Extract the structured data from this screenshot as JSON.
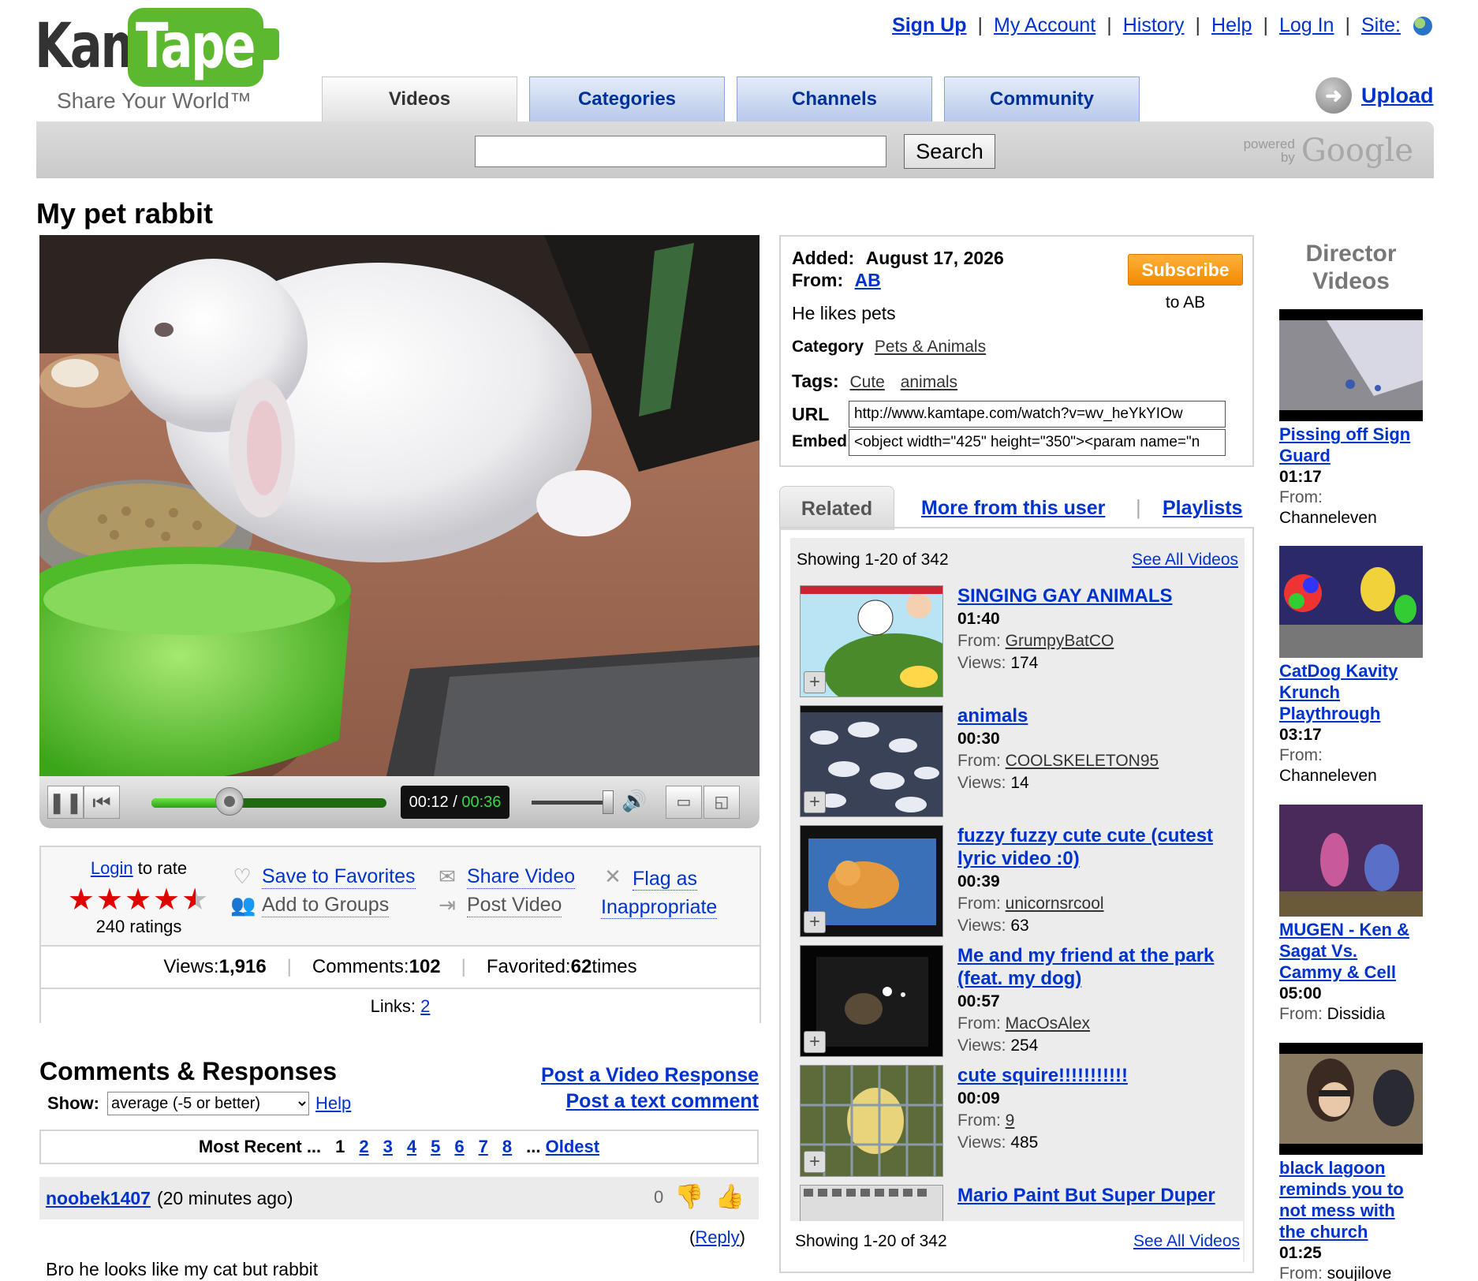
{
  "header": {
    "logo_left": "Kam",
    "logo_right": "Tape",
    "tagline": "Share Your World™",
    "links": [
      "Sign Up",
      "My Account",
      "History",
      "Help",
      "Log In",
      "Site:"
    ],
    "tabs": [
      "Videos",
      "Categories",
      "Channels",
      "Community"
    ],
    "active_tab": "Videos",
    "upload_label": "Upload",
    "search_value": "",
    "search_button": "Search",
    "powered_line1": "powered",
    "powered_line2": "by",
    "powered_brand": "Google"
  },
  "video": {
    "title": "My pet rabbit",
    "time_current": "00:12",
    "time_sep": " / ",
    "time_total": "00:36",
    "progress_fraction": 0.333
  },
  "rating": {
    "login_label": "Login",
    "to_rate": " to rate",
    "stars": 4.5,
    "ratings_count": "240 ratings"
  },
  "actions": {
    "save_favorites": "Save to Favorites",
    "add_groups": "Add to Groups",
    "share_video": "Share Video",
    "post_video": "Post Video",
    "flag_line1": "Flag as",
    "flag_line2": "Inappropriate"
  },
  "stats": {
    "views_label": "Views: ",
    "views": "1,916",
    "comments_label": "Comments: ",
    "comments": "102",
    "favorited_label": "Favorited: ",
    "favorited": "62",
    "favorited_suffix": " times",
    "links_label": "Links: ",
    "links": "2"
  },
  "comments": {
    "title": "Comments & Responses",
    "post_video_response": "Post a Video Response",
    "post_text_comment": "Post a text comment",
    "show_label": "Show:",
    "show_value": "average (-5 or better)",
    "help": "Help",
    "pager_most_recent": "Most Recent ...",
    "pager_current": "1",
    "pager_pages": [
      "2",
      "3",
      "4",
      "5",
      "6",
      "7",
      "8"
    ],
    "pager_oldest_prefix": "...",
    "pager_oldest": "Oldest",
    "first": {
      "user": "noobek1407",
      "when": "(20 minutes ago)",
      "votes": "0",
      "reply_open": "(",
      "reply": "Reply",
      "reply_close": ")",
      "text": "Bro he looks like my cat but rabbit"
    }
  },
  "info": {
    "added_label": "Added:",
    "added": "August 17, 2026",
    "from_label": "From:",
    "from": "AB",
    "subscribe": "Subscribe",
    "subscribe_to": "to AB",
    "description": "He likes pets",
    "category_label": "Category",
    "category": "Pets & Animals",
    "tags_label": "Tags:",
    "tags": [
      "Cute",
      "animals"
    ],
    "url_label": "URL",
    "url": "http://www.kamtape.com/watch?v=wv_heYkYIOw",
    "embed_label": "Embed",
    "embed": "<object width=\"425\" height=\"350\"><param name=\"n"
  },
  "related": {
    "tabs": [
      "Related",
      "More from this user",
      "Playlists"
    ],
    "showing": "Showing 1-20 of 342",
    "see_all": "See All Videos",
    "items": [
      {
        "title": "SINGING GAY ANIMALS",
        "duration": "01:40",
        "from": "GrumpyBatCO",
        "views": "174"
      },
      {
        "title": "animals",
        "duration": "00:30",
        "from": "COOLSKELETON95",
        "views": "14"
      },
      {
        "title": "fuzzy fuzzy cute cute (cutest lyric video :0)",
        "duration": "00:39",
        "from": "unicornsrcool",
        "views": "63"
      },
      {
        "title": "Me and my friend at the park (feat. my dog)",
        "duration": "00:57",
        "from": "MacOsAlex",
        "views": "254"
      },
      {
        "title": "cute squire!!!!!!!!!!!",
        "duration": "00:09",
        "from": "9",
        "views": "485"
      },
      {
        "title": "Mario Paint But Super Duper",
        "duration": "",
        "from": "",
        "views": ""
      }
    ],
    "from_label": "From: ",
    "views_label": "Views: "
  },
  "director": {
    "title_line1": "Director",
    "title_line2": "Videos",
    "from_label": "From:",
    "items": [
      {
        "title": "Pissing off Sign Guard",
        "duration": "01:17",
        "from": "Channeleven"
      },
      {
        "title": "CatDog Kavity Krunch Playthrough",
        "duration": "03:17",
        "from": "Channeleven"
      },
      {
        "title": "MUGEN - Ken & Sagat Vs. Cammy & Cell",
        "duration": "05:00",
        "from": "Dissidia"
      },
      {
        "title": "black lagoon reminds you to not mess with the church",
        "duration": "01:25",
        "from": "soujilove"
      }
    ]
  },
  "colors": {
    "link": "#0033cc",
    "subscribe": "#f28a00",
    "progress": "#2aa314"
  }
}
